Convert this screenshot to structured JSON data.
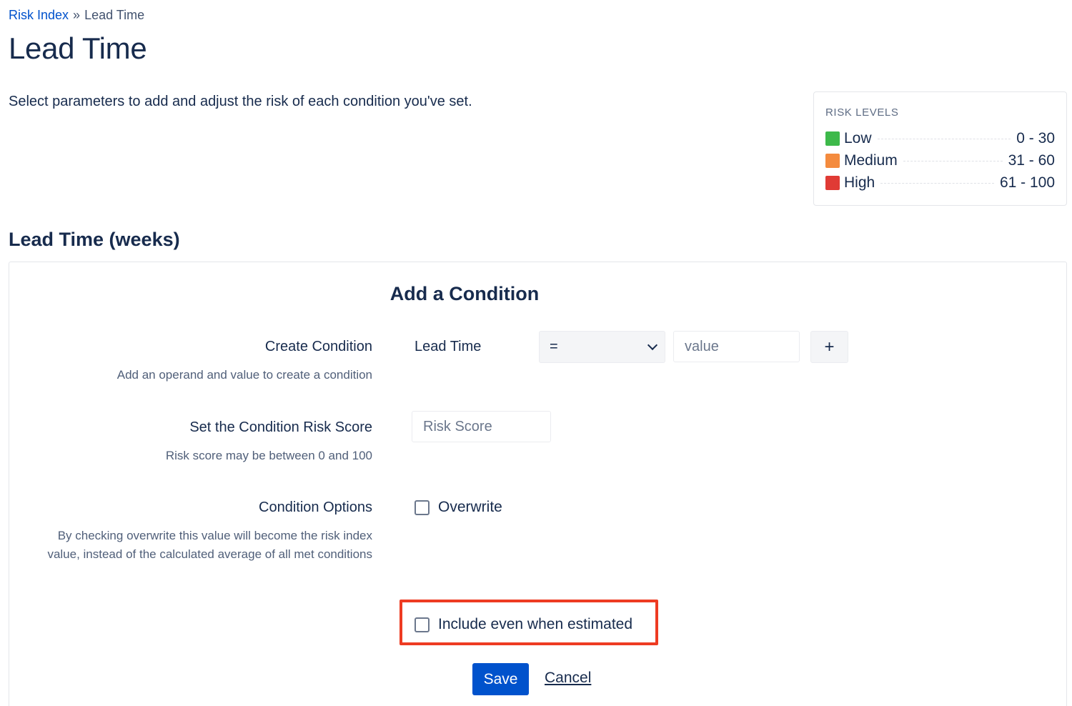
{
  "breadcrumb": {
    "parent": "Risk Index",
    "separator": "»",
    "current": "Lead Time"
  },
  "page": {
    "title": "Lead Time",
    "intro": "Select parameters to add and adjust the risk of each condition you've set."
  },
  "risk_levels": {
    "title": "RISK LEVELS",
    "items": [
      {
        "name": "Low",
        "range": "0 - 30",
        "color": "#3db94a"
      },
      {
        "name": "Medium",
        "range": "31 - 60",
        "color": "#f48b3e"
      },
      {
        "name": "High",
        "range": "61 - 100",
        "color": "#e03b35"
      }
    ]
  },
  "section": {
    "title": "Lead Time (weeks)"
  },
  "form": {
    "title": "Add a Condition",
    "create_condition": {
      "label": "Create Condition",
      "description": "Add an operand and value to create a condition",
      "field_name": "Lead Time",
      "operator": "=",
      "value_placeholder": "value",
      "add_label": "+"
    },
    "risk_score": {
      "label": "Set the Condition Risk Score",
      "description": "Risk score may be between 0 and 100",
      "placeholder": "Risk Score"
    },
    "options": {
      "label": "Condition Options",
      "description": "By checking overwrite this value will become the risk index value, instead of the calculated average of all met conditions",
      "overwrite_label": "Overwrite",
      "include_estimated_label": "Include even when estimated"
    },
    "actions": {
      "save_label": "Save",
      "cancel_label": "Cancel"
    }
  },
  "colors": {
    "primary": "#0052cc",
    "text": "#172b4d",
    "highlight": "#ee3b22"
  }
}
